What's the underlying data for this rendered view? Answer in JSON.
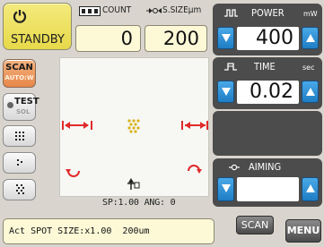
{
  "status": {
    "standby_label": "STANDBY"
  },
  "left_buttons": {
    "scan_label": "SCAN",
    "scan_sub": "AUTO:W",
    "test_label": "TEST",
    "test_sub": "SOL"
  },
  "counter": {
    "count_label": "COUNT",
    "count_value": "0",
    "spot_size_label": "S.SIZE",
    "spot_size_unit": "μm",
    "spot_size_value": "200"
  },
  "preview": {
    "status_text": "SP:1.00 ANG:  0"
  },
  "power": {
    "title": "POWER",
    "unit": "mW",
    "value": "400"
  },
  "time": {
    "title": "TIME",
    "unit": "sec",
    "value": "0.02"
  },
  "aiming": {
    "title": "AIMING",
    "value": ""
  },
  "bottom": {
    "message": "Act SPOT SIZE:x1.00  200um",
    "scan_button": "SCAN",
    "menu_button": "MENU"
  },
  "colors": {
    "standby_yellow": "#e9dc50",
    "scan_orange": "#e98a4c",
    "arrow_blue": "#2b8fd6",
    "panel_dark": "#4c4c4c",
    "value_box_cream": "#fdf9d7",
    "marker_red": "#e02a2a",
    "spot_yellow": "#d8b21a"
  }
}
